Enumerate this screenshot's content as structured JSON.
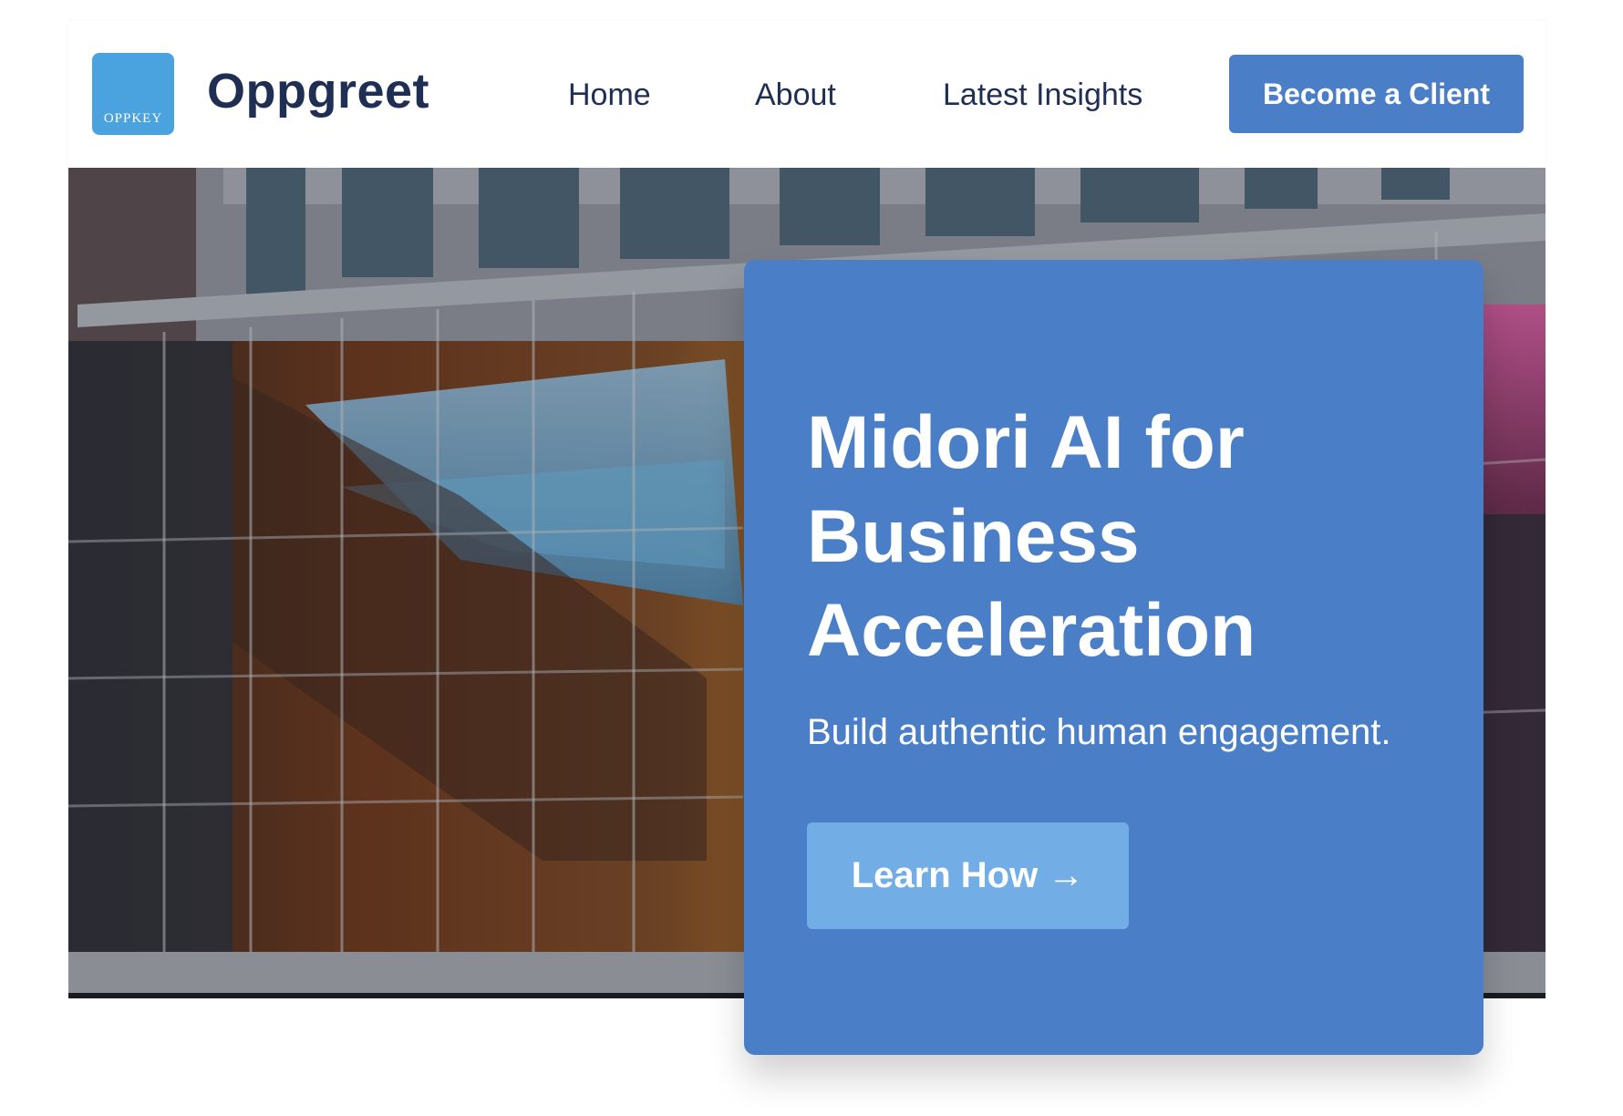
{
  "header": {
    "logo_text": "OPPKEY",
    "brand_name": "Oppgreet",
    "nav": {
      "home": "Home",
      "about": "About",
      "insights": "Latest Insights"
    },
    "cta_label": "Become a Client"
  },
  "hero": {
    "image": "glass-building-facade-image",
    "card": {
      "title": "Midori AI for Business Acceleration",
      "subtitle": "Build authentic human engagement.",
      "button_label": "Learn How →"
    }
  },
  "colors": {
    "primary": "#4a7ec7",
    "navy_text": "#1f2f54",
    "logo_blue": "#4aa3df",
    "light_button": "#73ade6"
  }
}
